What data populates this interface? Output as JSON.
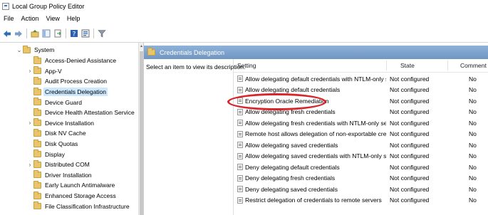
{
  "window": {
    "title": "Local Group Policy Editor",
    "icon": "policy-editor-icon"
  },
  "menu": [
    "File",
    "Action",
    "View",
    "Help"
  ],
  "toolbar": [
    "back-icon",
    "forward-icon",
    "up-folder-icon",
    "show-hide-tree-icon",
    "export-list-icon",
    "help-icon",
    "properties-icon",
    "filter-icon"
  ],
  "tree": {
    "root": "System",
    "items": [
      {
        "label": "Access-Denied Assistance",
        "expandable": false
      },
      {
        "label": "App-V",
        "expandable": true
      },
      {
        "label": "Audit Process Creation",
        "expandable": false
      },
      {
        "label": "Credentials Delegation",
        "expandable": false,
        "selected": true
      },
      {
        "label": "Device Guard",
        "expandable": false
      },
      {
        "label": "Device Health Attestation Service",
        "expandable": false
      },
      {
        "label": "Device Installation",
        "expandable": true
      },
      {
        "label": "Disk NV Cache",
        "expandable": false
      },
      {
        "label": "Disk Quotas",
        "expandable": false
      },
      {
        "label": "Display",
        "expandable": false
      },
      {
        "label": "Distributed COM",
        "expandable": true
      },
      {
        "label": "Driver Installation",
        "expandable": false
      },
      {
        "label": "Early Launch Antimalware",
        "expandable": false
      },
      {
        "label": "Enhanced Storage Access",
        "expandable": false
      },
      {
        "label": "File Classification Infrastructure",
        "expandable": false
      }
    ]
  },
  "panel": {
    "title": "Credentials Delegation",
    "description": "Select an item to view its description.",
    "columns": {
      "setting": "Setting",
      "state": "State",
      "comment": "Comment"
    },
    "rows": [
      {
        "setting": "Allow delegating default credentials with NTLM-only server a...",
        "state": "Not configured",
        "comment": "No"
      },
      {
        "setting": "Allow delegating default credentials",
        "state": "Not configured",
        "comment": "No"
      },
      {
        "setting": "Encryption Oracle Remediation",
        "state": "Not configured",
        "comment": "No"
      },
      {
        "setting": "Allow delegating fresh credentials",
        "state": "Not configured",
        "comment": "No"
      },
      {
        "setting": "Allow delegating fresh credentials with NTLM-only server aut...",
        "state": "Not configured",
        "comment": "No"
      },
      {
        "setting": "Remote host allows delegation of non-exportable credentials",
        "state": "Not configured",
        "comment": "No"
      },
      {
        "setting": "Allow delegating saved credentials",
        "state": "Not configured",
        "comment": "No"
      },
      {
        "setting": "Allow delegating saved credentials with NTLM-only server aut...",
        "state": "Not configured",
        "comment": "No"
      },
      {
        "setting": "Deny delegating default credentials",
        "state": "Not configured",
        "comment": "No"
      },
      {
        "setting": "Deny delegating fresh credentials",
        "state": "Not configured",
        "comment": "No"
      },
      {
        "setting": "Deny delegating saved credentials",
        "state": "Not configured",
        "comment": "No"
      },
      {
        "setting": "Restrict delegation of credentials to remote servers",
        "state": "Not configured",
        "comment": "No"
      }
    ]
  },
  "colors": {
    "header": "#7ba1cc",
    "selection": "#cce8ff",
    "annotation": "#d8242b",
    "folder": "#e8c56a"
  }
}
